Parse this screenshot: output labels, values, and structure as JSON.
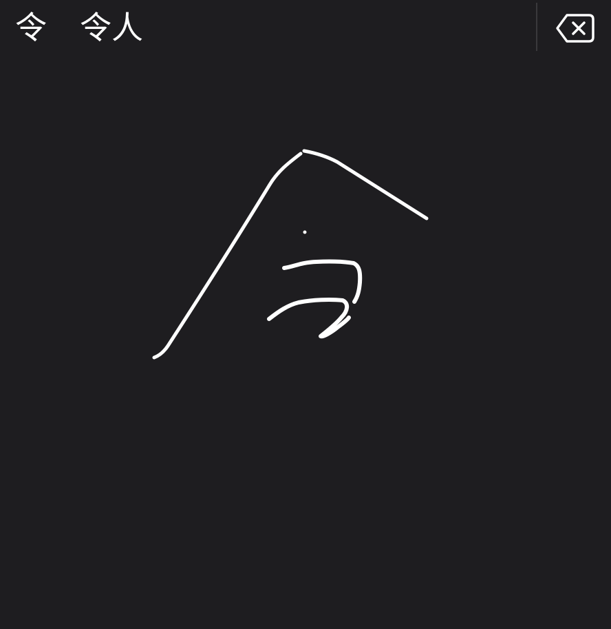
{
  "candidates": [
    "令",
    "令人"
  ],
  "icons": {
    "delete": "delete-backward-icon"
  },
  "colors": {
    "background": "#1e1d20",
    "text": "#ffffff",
    "ink": "#ffffff",
    "divider": "#3a393c"
  }
}
